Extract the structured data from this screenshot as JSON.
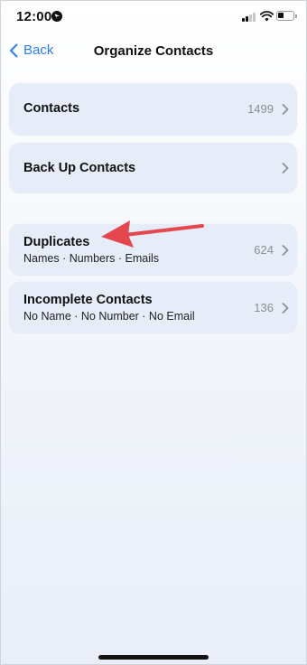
{
  "status_bar": {
    "time": "12:00"
  },
  "nav": {
    "back_label": "Back",
    "title": "Organize Contacts"
  },
  "rows": {
    "contacts": {
      "label": "Contacts",
      "count": "1499"
    },
    "backup": {
      "label": "Back Up Contacts"
    },
    "duplicates": {
      "label": "Duplicates",
      "subtitle": "Names · Numbers · Emails",
      "count": "624"
    },
    "incomplete": {
      "label": "Incomplete Contacts",
      "subtitle": "No Name · No Number · No Email",
      "count": "136"
    }
  },
  "colors": {
    "accent": "#2e7cf6",
    "card": "#e6ecf8",
    "annotation_arrow": "#e5474f"
  },
  "icons": [
    "location-icon",
    "cellular-signal-icon",
    "wifi-icon",
    "battery-icon",
    "chevron-left-icon",
    "chevron-right-icon"
  ]
}
